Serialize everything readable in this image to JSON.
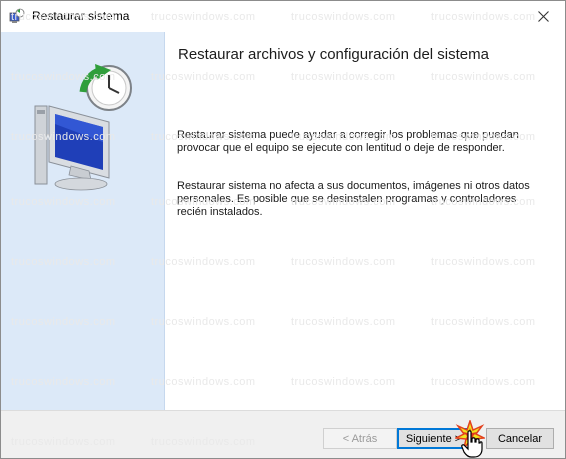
{
  "window": {
    "title": "Restaurar sistema",
    "title_icon": "system-restore-icon",
    "close_icon": "close-icon"
  },
  "side": {
    "hero_icon": "system-restore-monitor-clock-icon"
  },
  "content": {
    "heading": "Restaurar archivos y configuración del sistema",
    "paragraph1": "Restaurar sistema puede ayudar a corregir los problemas que puedan provocar que el equipo se ejecute con lentitud o deje de responder.",
    "paragraph2": "Restaurar sistema no afecta a sus documentos, imágenes ni otros datos personales. Es posible que se desinstalen programas y controladores recién instalados."
  },
  "footer": {
    "back_label": "< Atrás",
    "next_label": "Siguiente >",
    "cancel_label": "Cancelar"
  },
  "watermark": "trucoswindows.com",
  "colors": {
    "side_panel": "#dce9f8",
    "focus_border": "#0078d7",
    "footer_bg": "#f0f0f0"
  }
}
